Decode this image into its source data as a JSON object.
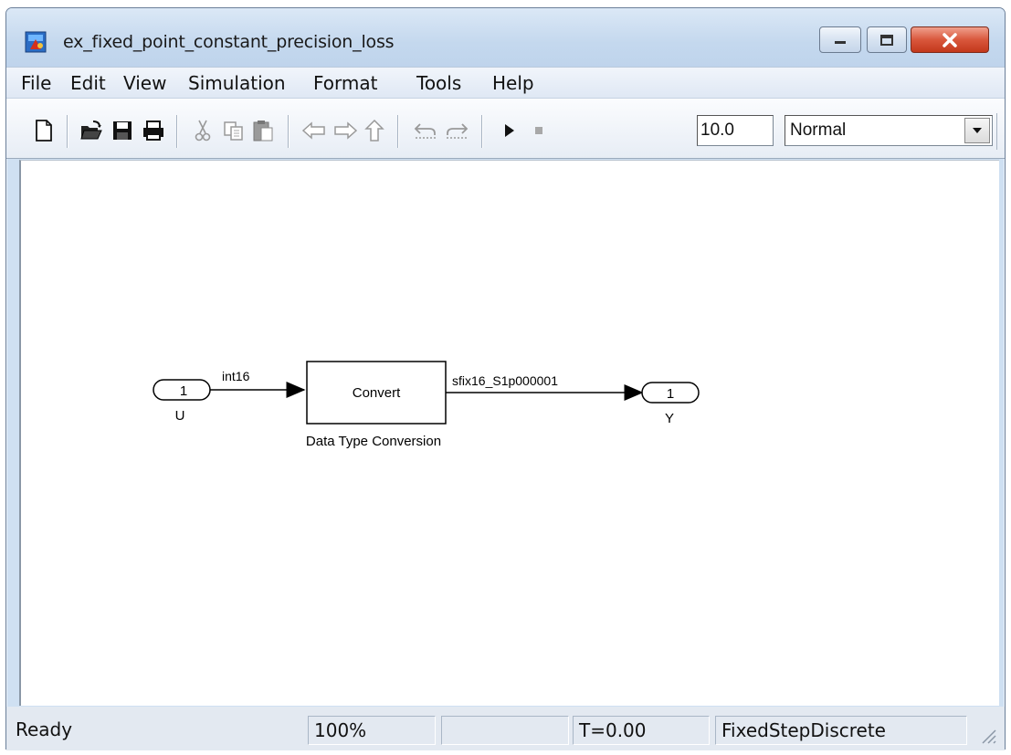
{
  "window": {
    "title": "ex_fixed_point_constant_precision_loss"
  },
  "menu": [
    {
      "label": "File"
    },
    {
      "label": "Edit"
    },
    {
      "label": "View"
    },
    {
      "label": "Simulation"
    },
    {
      "label": "Format"
    },
    {
      "label": "Tools"
    },
    {
      "label": "Help"
    }
  ],
  "toolbar": {
    "icons": [
      "new-file-icon",
      "open-folder-icon",
      "save-icon",
      "print-icon",
      "cut-icon",
      "copy-icon",
      "paste-icon",
      "back-arrow-icon",
      "forward-arrow-icon",
      "up-arrow-icon",
      "undo-icon",
      "redo-icon",
      "play-icon",
      "stop-icon"
    ],
    "stop_time": "10.0",
    "sim_mode": "Normal"
  },
  "diagram": {
    "inport": {
      "port_number": "1",
      "name": "U"
    },
    "outport": {
      "port_number": "1",
      "name": "Y"
    },
    "block": {
      "text": "Convert",
      "name": "Data Type Conversion"
    },
    "signal_in_label": "int16",
    "signal_out_label": "sfix16_S1p000001"
  },
  "status": {
    "state": "Ready",
    "zoom": "100%",
    "blank": "",
    "time": "T=0.00",
    "solver": "FixedStepDiscrete"
  }
}
